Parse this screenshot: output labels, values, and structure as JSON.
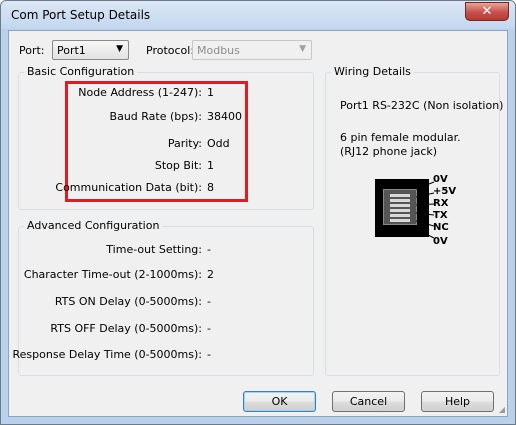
{
  "window": {
    "title": "Com Port Setup Details",
    "close_glyph": "✕"
  },
  "port": {
    "label": "Port:",
    "value": "Port1"
  },
  "protocol": {
    "label": "Protocol:",
    "value": "Modbus"
  },
  "basic": {
    "title": "Basic Configuration",
    "rows": [
      {
        "label": "Node Address (1-247):",
        "value": "1"
      },
      {
        "label": "Baud Rate (bps):",
        "value": "38400"
      },
      {
        "label": "Parity:",
        "value": "Odd"
      },
      {
        "label": "Stop Bit:",
        "value": "1"
      },
      {
        "label": "Communication Data (bit):",
        "value": "8"
      }
    ]
  },
  "advanced": {
    "title": "Advanced Configuration",
    "rows": [
      {
        "label": "Time-out Setting:",
        "value": "-"
      },
      {
        "label": "Character Time-out (2-1000ms):",
        "value": "2"
      },
      {
        "label": "RTS ON Delay (0-5000ms):",
        "value": "-"
      },
      {
        "label": "RTS OFF Delay (0-5000ms):",
        "value": "-"
      },
      {
        "label": "Response Delay Time (0-5000ms):",
        "value": "-"
      }
    ]
  },
  "wiring": {
    "title": "Wiring Details",
    "port_desc": "Port1 RS-232C (Non isolation)",
    "jack_line1": "6 pin female modular.",
    "jack_line2": "(RJ12 phone jack)",
    "pins": [
      "0V",
      "+5V",
      "RX",
      "TX",
      "NC",
      "0V"
    ]
  },
  "buttons": {
    "ok": "OK",
    "cancel": "Cancel",
    "help": "Help"
  },
  "colors": {
    "highlight": "#e01c22",
    "close": "#c75050"
  }
}
